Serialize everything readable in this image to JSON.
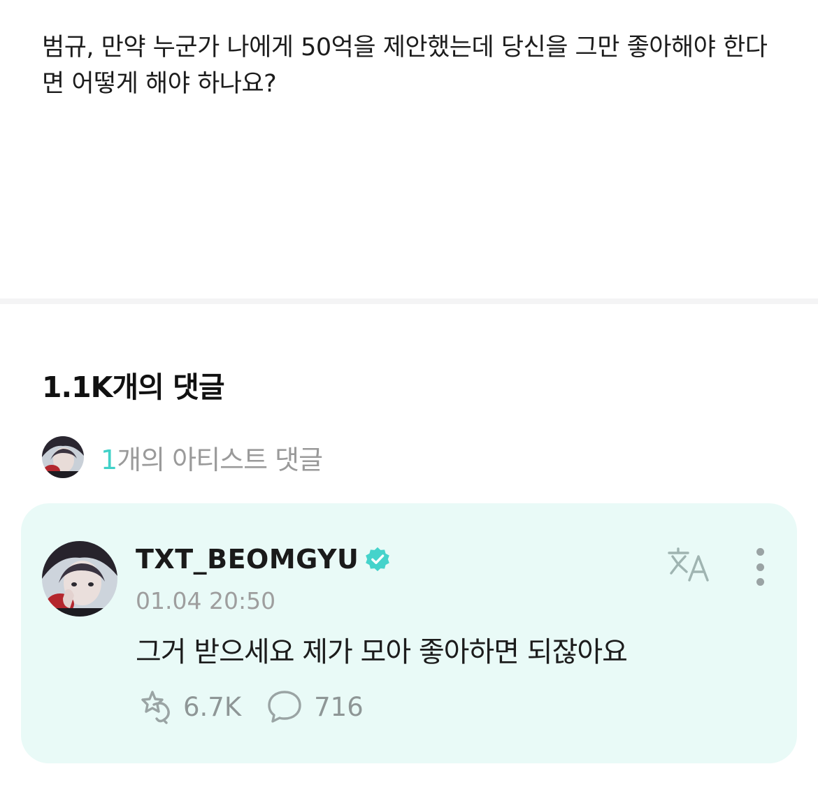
{
  "post": {
    "text": "범규, 만약 누군가 나에게 50억을 제안했는데 당신을 그만 좋아해야 한다면 어떻게 해야 하나요?"
  },
  "comments": {
    "heading": "1.1K개의 댓글",
    "artist_count": "1",
    "artist_label": "개의 아티스트 댓글"
  },
  "comment": {
    "username": "TXT_BEOMGYU",
    "timestamp": "01.04 20:50",
    "text": "그거 받으세요 제가 모아 좋아하면 되잖아요",
    "likes": "6.7K",
    "replies": "716"
  },
  "colors": {
    "accent": "#41d1c8",
    "card_background": "#e9faf7",
    "verified_badge": "#45d3cb"
  },
  "icons": {
    "verified": "verified-badge-icon",
    "translate": "translate-icon",
    "more": "more-options-icon",
    "like": "like-icon",
    "reply": "comment-bubble-icon"
  }
}
